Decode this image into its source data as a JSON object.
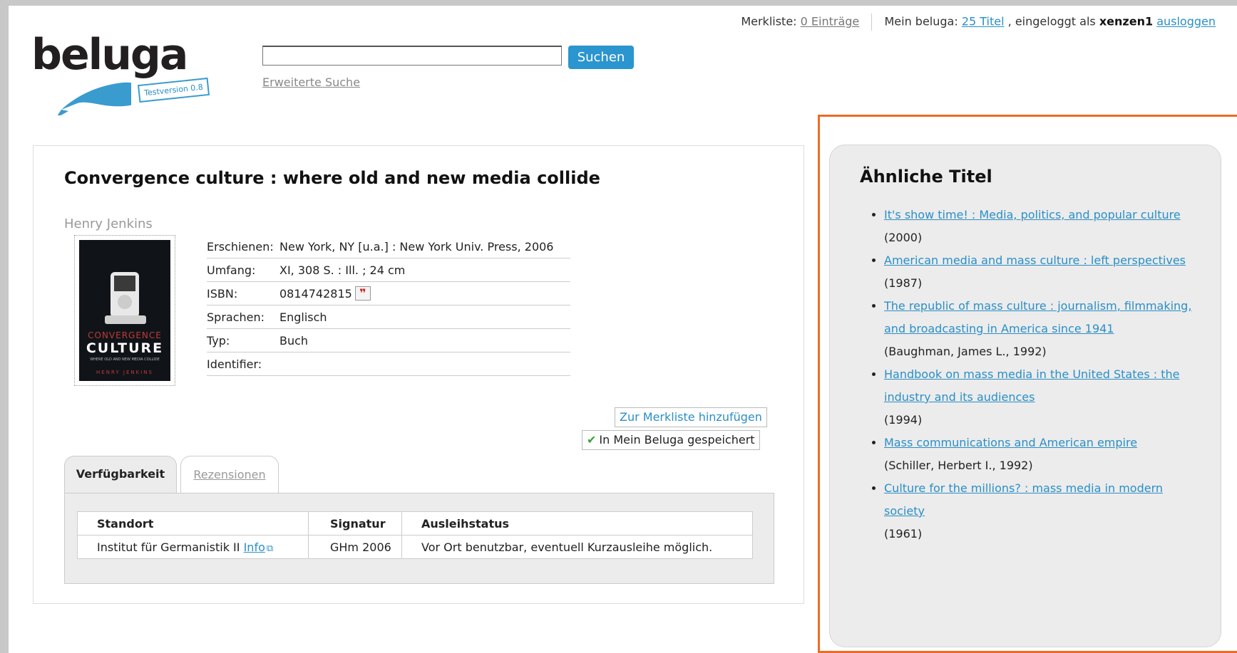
{
  "userbar": {
    "merkliste_label": "Merkliste:",
    "merkliste_link": "0 Einträge",
    "mein_label": "Mein beluga:",
    "mein_link": "25 Titel",
    "logged_in_text": ", eingeloggt als",
    "username": "xenzen1",
    "logout": "ausloggen"
  },
  "logo": {
    "text": "beluga",
    "badge": "Testversion 0.8"
  },
  "search": {
    "value": "",
    "button": "Suchen",
    "advanced": "Erweiterte Suche"
  },
  "record": {
    "title": "Convergence culture : where old and new media collide",
    "author": "Henry Jenkins",
    "cover": {
      "line1": "CONVERGENCE",
      "line2": "CULTURE",
      "line3": "WHERE OLD AND NEW MEDIA COLLIDE",
      "line4": "HENRY JENKINS"
    },
    "meta": [
      {
        "label": "Erschienen:",
        "value": "New York, NY [u.a.] : New York Univ. Press, 2006"
      },
      {
        "label": "Umfang:",
        "value": "XI, 308 S. : Ill. ; 24 cm"
      },
      {
        "label": "ISBN:",
        "value": "0814742815"
      },
      {
        "label": "Sprachen:",
        "value": "Englisch"
      },
      {
        "label": "Typ:",
        "value": "Buch"
      },
      {
        "label": "Identifier:",
        "value": ""
      }
    ],
    "quote_icon": "citation-icon",
    "add_to_list": "Zur Merkliste hinzufügen",
    "saved": "In Mein Beluga gespeichert"
  },
  "tabs": [
    {
      "label": "Verfügbarkeit",
      "active": true
    },
    {
      "label": "Rezensionen",
      "active": false
    }
  ],
  "availability": {
    "headers": [
      "Standort",
      "Signatur",
      "Ausleihstatus"
    ],
    "row": {
      "standort": "Institut für Germanistik II",
      "info": "Info",
      "signatur": "GHm 2006",
      "status": "Vor Ort benutzbar, eventuell Kurzausleihe möglich."
    }
  },
  "similar": {
    "heading": "Ähnliche Titel",
    "items": [
      {
        "title": "It's show time! : Media, politics, and popular culture",
        "sub": "(2000)"
      },
      {
        "title": "American media and mass culture : left perspectives",
        "sub": "(1987)"
      },
      {
        "title": "The republic of mass culture : journalism, filmmaking, and broadcasting in America since 1941",
        "sub": "(Baughman, James L., 1992)"
      },
      {
        "title": "Handbook on mass media in the United States : the industry and its audiences",
        "sub": "(1994)"
      },
      {
        "title": "Mass communications and American empire",
        "sub": "(Schiller, Herbert I., 1992)"
      },
      {
        "title": "Culture for the millions? : mass media in modern society",
        "sub": "(1961)"
      }
    ]
  },
  "colors": {
    "link": "#2a8fc7",
    "accent_button": "#2b95cf",
    "highlight": "#ee6b25",
    "panel_bg": "#ececec"
  }
}
